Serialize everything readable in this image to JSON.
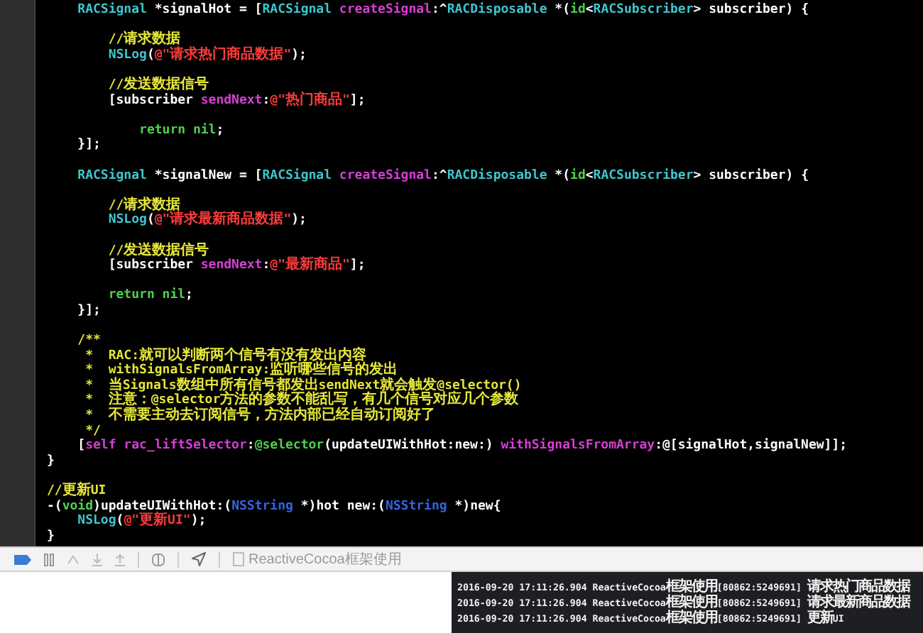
{
  "editor": {
    "blocks": [
      [
        [
          {
            "kind": "type",
            "text": "    RACSignal"
          },
          {
            "kind": "plain",
            "text": " *signalHot = ["
          },
          {
            "kind": "type",
            "text": "RACSignal"
          },
          {
            "kind": "method",
            "text": " createSignal"
          },
          {
            "kind": "plain",
            "text": ":^"
          },
          {
            "kind": "type",
            "text": "RACDisposable"
          },
          {
            "kind": "plain",
            "text": " *("
          },
          {
            "kind": "keyword",
            "text": "id"
          },
          {
            "kind": "plain",
            "text": "<"
          },
          {
            "kind": "type",
            "text": "RACSubscriber"
          },
          {
            "kind": "plain",
            "text": "> subscriber) {"
          }
        ]
      ],
      [
        [
          {
            "kind": "comment",
            "text": "        //请求数据"
          }
        ],
        [
          {
            "kind": "type",
            "text": "        NSLog"
          },
          {
            "kind": "plain",
            "text": "("
          },
          {
            "kind": "string",
            "text": "@\"请求热门商品数据\""
          },
          {
            "kind": "plain",
            "text": ");"
          }
        ]
      ],
      [
        [
          {
            "kind": "comment",
            "text": "        //发送数据信号"
          }
        ],
        [
          {
            "kind": "plain",
            "text": "        [subscriber "
          },
          {
            "kind": "method",
            "text": "sendNext"
          },
          {
            "kind": "plain",
            "text": ":"
          },
          {
            "kind": "string",
            "text": "@\"热门商品\""
          },
          {
            "kind": "plain",
            "text": "];"
          }
        ]
      ],
      [
        [
          {
            "kind": "keyword",
            "text": "            return nil"
          },
          {
            "kind": "plain",
            "text": ";"
          }
        ],
        [
          {
            "kind": "plain",
            "text": "    }];"
          }
        ]
      ],
      [
        [
          {
            "kind": "type",
            "text": "    RACSignal"
          },
          {
            "kind": "plain",
            "text": " *signalNew = ["
          },
          {
            "kind": "type",
            "text": "RACSignal"
          },
          {
            "kind": "method",
            "text": " createSignal"
          },
          {
            "kind": "plain",
            "text": ":^"
          },
          {
            "kind": "type",
            "text": "RACDisposable"
          },
          {
            "kind": "plain",
            "text": " *("
          },
          {
            "kind": "keyword",
            "text": "id"
          },
          {
            "kind": "plain",
            "text": "<"
          },
          {
            "kind": "type",
            "text": "RACSubscriber"
          },
          {
            "kind": "plain",
            "text": "> subscriber) {"
          }
        ]
      ],
      [
        [
          {
            "kind": "comment",
            "text": "        //请求数据"
          }
        ],
        [
          {
            "kind": "type",
            "text": "        NSLog"
          },
          {
            "kind": "plain",
            "text": "("
          },
          {
            "kind": "string",
            "text": "@\"请求最新商品数据\""
          },
          {
            "kind": "plain",
            "text": ");"
          }
        ]
      ],
      [
        [
          {
            "kind": "comment",
            "text": "        //发送数据信号"
          }
        ],
        [
          {
            "kind": "plain",
            "text": "        [subscriber "
          },
          {
            "kind": "method",
            "text": "sendNext"
          },
          {
            "kind": "plain",
            "text": ":"
          },
          {
            "kind": "string",
            "text": "@\"最新商品\""
          },
          {
            "kind": "plain",
            "text": "];"
          }
        ]
      ],
      [
        [
          {
            "kind": "keyword",
            "text": "        return nil"
          },
          {
            "kind": "plain",
            "text": ";"
          }
        ],
        [
          {
            "kind": "plain",
            "text": "    }];"
          }
        ]
      ],
      [
        [
          {
            "kind": "comment",
            "text": "    /**"
          }
        ],
        [
          {
            "kind": "comment",
            "text": "     *  RAC:就可以判断两个信号有没有发出内容"
          }
        ],
        [
          {
            "kind": "comment",
            "text": "     *  withSignalsFromArray:监听哪些信号的发出"
          }
        ],
        [
          {
            "kind": "comment",
            "text": "     *  当Signals数组中所有信号都发出sendNext就会触发@selector()"
          }
        ],
        [
          {
            "kind": "comment",
            "text": "     *  注意：@selector方法的参数不能乱写，有几个信号对应几个参数"
          }
        ],
        [
          {
            "kind": "comment",
            "text": "     *  不需要主动去订阅信号，方法内部已经自动订阅好了"
          }
        ],
        [
          {
            "kind": "comment",
            "text": "     */"
          }
        ],
        [
          {
            "kind": "plain",
            "text": "    ["
          },
          {
            "kind": "method",
            "text": "self rac_liftSelector"
          },
          {
            "kind": "plain",
            "text": ":"
          },
          {
            "kind": "keyword",
            "text": "@selector"
          },
          {
            "kind": "plain",
            "text": "(updateUIWithHot:new:) "
          },
          {
            "kind": "method",
            "text": "withSignalsFromArray"
          },
          {
            "kind": "plain",
            "text": ":@[signalHot,signalNew]];"
          }
        ],
        [
          {
            "kind": "plain",
            "text": "}"
          }
        ]
      ],
      [
        [
          {
            "kind": "comment",
            "text": "//更新UI"
          }
        ],
        [
          {
            "kind": "plain",
            "text": "-("
          },
          {
            "kind": "keyword",
            "text": "void"
          },
          {
            "kind": "plain",
            "text": ")updateUIWithHot:("
          },
          {
            "kind": "class",
            "text": "NSString"
          },
          {
            "kind": "plain",
            "text": " *)hot new:("
          },
          {
            "kind": "class",
            "text": "NSString"
          },
          {
            "kind": "plain",
            "text": " *)new{"
          }
        ],
        [
          {
            "kind": "type",
            "text": "    NSLog"
          },
          {
            "kind": "plain",
            "text": "("
          },
          {
            "kind": "string",
            "text": "@\"更新UI\""
          },
          {
            "kind": "plain",
            "text": ");"
          }
        ],
        [
          {
            "kind": "plain",
            "text": "}"
          }
        ]
      ]
    ]
  },
  "debug_bar": {
    "target": "ReactiveCocoa框架使用"
  },
  "console": {
    "lines": [
      "2016-09-20 17:11:26.904 ReactiveCocoa框架使用[80862:5249691] 请求热门商品数据",
      "2016-09-20 17:11:26.904 ReactiveCocoa框架使用[80862:5249691] 请求最新商品数据",
      "2016-09-20 17:11:26.904 ReactiveCocoa框架使用[80862:5249691] 更新UI"
    ]
  }
}
